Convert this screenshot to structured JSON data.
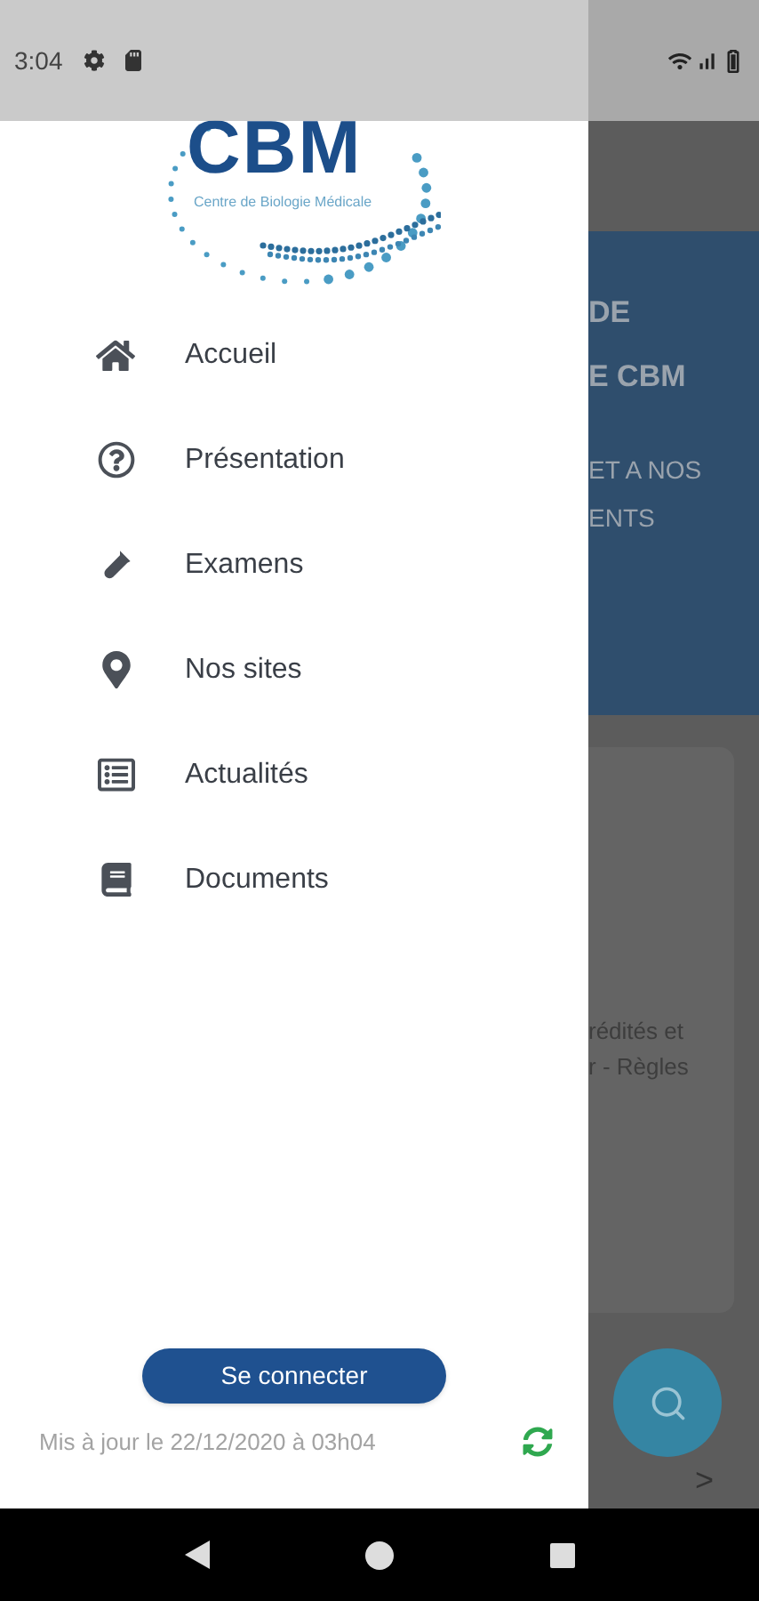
{
  "status_bar": {
    "time": "3:04"
  },
  "drawer": {
    "logo": {
      "title": "CBM",
      "subtitle": "Centre de Biologie Médicale"
    },
    "items": [
      {
        "label": "Accueil",
        "kind": "home"
      },
      {
        "label": "Présentation",
        "kind": "help"
      },
      {
        "label": "Examens",
        "kind": "tube"
      },
      {
        "label": "Nos sites",
        "kind": "pin"
      },
      {
        "label": "Actualités",
        "kind": "list"
      },
      {
        "label": "Documents",
        "kind": "book"
      }
    ],
    "login_button": "Se connecter",
    "updated": "Mis à jour le 22/12/2020 à 03h04"
  },
  "background": {
    "hero_lines": [
      "DE",
      "E CBM",
      "ET A NOS",
      "ENTS"
    ],
    "card_lines": [
      "rédités et",
      "r - Règles"
    ],
    "arrow": ">"
  }
}
